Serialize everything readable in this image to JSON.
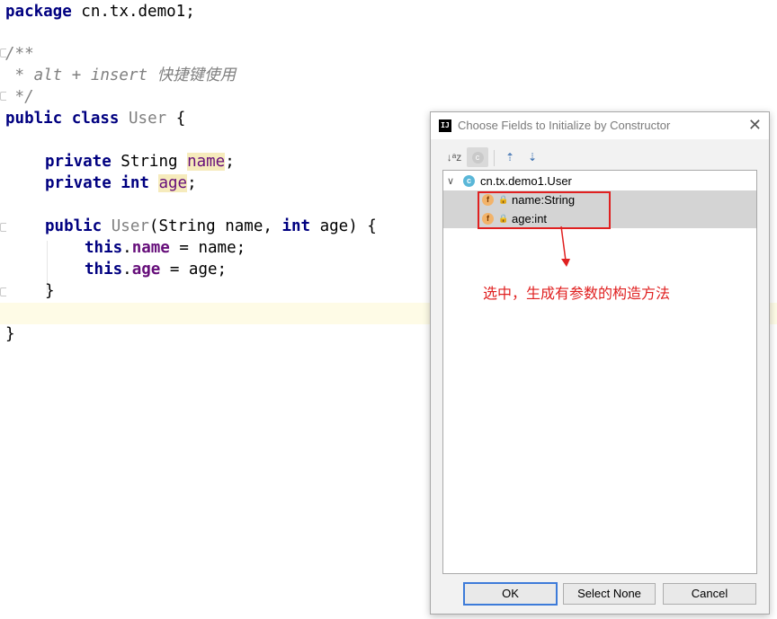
{
  "editor": {
    "line1": {
      "kw": "package",
      "rest": " cn.tx.demo1;"
    },
    "comment_open": "/**",
    "comment_text": " * alt + insert 快捷键使用",
    "comment_close": " */",
    "class_decl": {
      "kw1": "public",
      "kw2": "class",
      "name": "User",
      "brace": " {"
    },
    "field1": {
      "kw": "private",
      "type": " String ",
      "name": "name",
      "end": ";"
    },
    "field2": {
      "kw1": "private",
      "kw2": "int",
      "name": "age",
      "end": ";"
    },
    "ctor": {
      "kw1": "public",
      "name": "User",
      "params_a": "(String name, ",
      "kw2": "int",
      "params_b": " age) {"
    },
    "body1": {
      "kw": "this",
      "dot": ".",
      "field": "name",
      "rest": " = name;"
    },
    "body2": {
      "kw": "this",
      "dot": ".",
      "field": "age",
      "rest": " = age;"
    },
    "ctor_close": "}",
    "class_close": "}"
  },
  "dialog": {
    "title": "Choose Fields to Initialize by Constructor",
    "close_glyph": "✕",
    "toolbar": {
      "sort_glyph": "↓ᵃz",
      "class_glyph": "c",
      "expand_glyph": "⇡",
      "collapse_glyph": "⇣"
    },
    "tree": {
      "root_chevron": "∨",
      "root_icon": "c",
      "root_label": "cn.tx.demo1.User",
      "fields": [
        {
          "icon": "f",
          "label": "name:String"
        },
        {
          "icon": "f",
          "label": "age:int"
        }
      ]
    },
    "buttons": {
      "ok": "OK",
      "select_none": "Select None",
      "cancel": "Cancel"
    }
  },
  "annotation": {
    "note": "选中，生成有参数的构造方法",
    "color": "#e02020"
  }
}
